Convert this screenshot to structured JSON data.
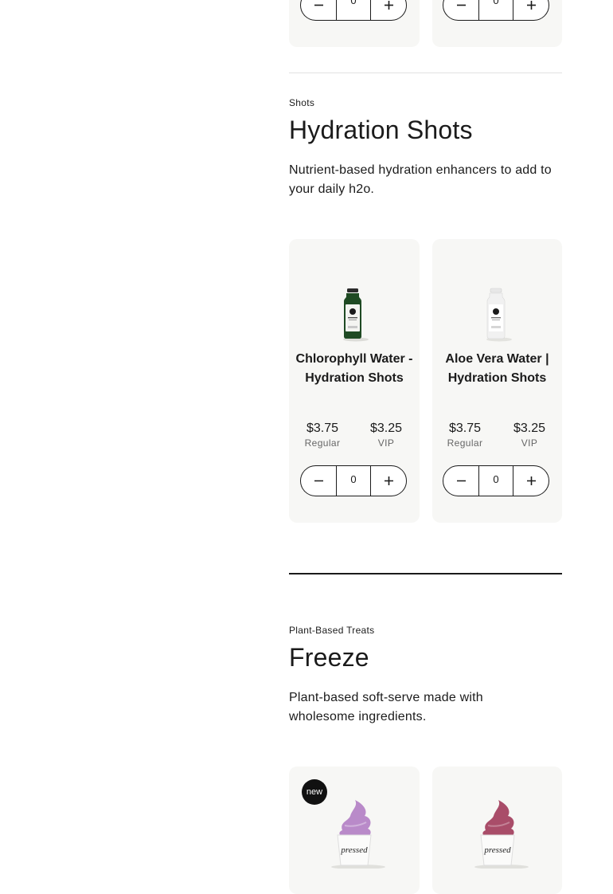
{
  "top_cards": [
    {
      "quantity": "0"
    },
    {
      "quantity": "0"
    }
  ],
  "shots_section": {
    "eyebrow": "Shots",
    "title": "Hydration Shots",
    "description": "Nutrient-based hydration enhancers to add to your daily h2o.",
    "products": [
      {
        "name": "Chlorophyll Water - Hydration Shots",
        "regular_price": "$3.75",
        "regular_label": "Regular",
        "vip_price": "$3.25",
        "vip_label": "VIP",
        "quantity": "0",
        "bottle_color": "#1f4a23"
      },
      {
        "name": "Aloe Vera Water | Hydration Shots",
        "regular_price": "$3.75",
        "regular_label": "Regular",
        "vip_price": "$3.25",
        "vip_label": "VIP",
        "quantity": "0",
        "bottle_color": "#f1f1f1"
      }
    ]
  },
  "freeze_section": {
    "eyebrow": "Plant-Based Treats",
    "title": "Freeze",
    "description": "Plant-based soft-serve made with wholesome ingredients.",
    "products": [
      {
        "badge": "new",
        "cup_text": "pressed",
        "swirl_color": "#b98ac9"
      },
      {
        "cup_text": "pressed",
        "swirl_color": "#a94d69"
      }
    ]
  },
  "icons": {
    "minus": "minus-icon",
    "plus": "plus-icon"
  },
  "colors": {
    "card_bg": "#f7f7f5",
    "text": "#1b1b1b"
  }
}
